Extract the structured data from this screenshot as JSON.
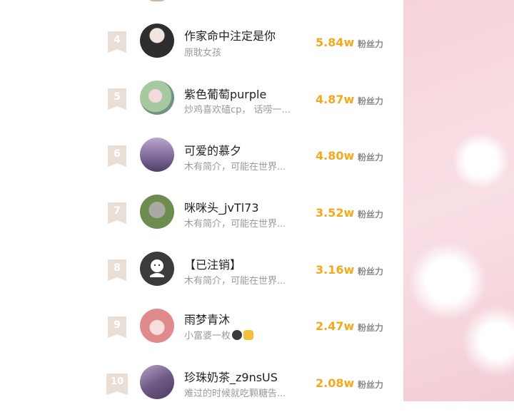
{
  "rows": [
    {
      "rank": "4",
      "name": "作家命中注定是你",
      "bio": "原耽女孩",
      "count": "5.84w",
      "unit": "粉丝力",
      "avatar_colors": [
        "#2e2e2e",
        "#e9e3e1"
      ]
    },
    {
      "rank": "5",
      "name": "紫色葡萄purple",
      "bio": "炒鸡喜欢磕cp，  话唠一...",
      "count": "4.87w",
      "unit": "粉丝力",
      "avatar_colors": [
        "#cfe4c9",
        "#8fb2a1"
      ]
    },
    {
      "rank": "6",
      "name": "可爱的慕夕",
      "bio": "木有简介，可能在世界...",
      "count": "4.80w",
      "unit": "粉丝力",
      "avatar_colors": [
        "#6e5a86",
        "#b7a8c7"
      ]
    },
    {
      "rank": "7",
      "name": "咪咪头_jvTl73",
      "bio": "木有简介，可能在世界...",
      "count": "3.52w",
      "unit": "粉丝力",
      "avatar_colors": [
        "#5f7c45",
        "#a3a89a"
      ]
    },
    {
      "rank": "8",
      "name": "【已注销】",
      "bio": "木有简介，可能在世界...",
      "count": "3.16w",
      "unit": "粉丝力",
      "avatar_colors": [
        "#3b3b3b",
        "#3b3b3b"
      ]
    },
    {
      "rank": "9",
      "name": "雨梦青沐",
      "bio": "小富婆一枚",
      "count": "2.47w",
      "unit": "粉丝力",
      "avatar_colors": [
        "#e08b8b",
        "#f3c0c0"
      ]
    },
    {
      "rank": "10",
      "name": "珍珠奶茶_z9nsUS",
      "bio": "难过的时候就吃颗糖告...",
      "count": "2.08w",
      "unit": "粉丝力",
      "avatar_colors": [
        "#5d4a6e",
        "#a08fb4"
      ]
    }
  ],
  "icons": {
    "bio_emoji_rank9": [
      "dark-face-icon",
      "thumbs-up-icon"
    ]
  }
}
